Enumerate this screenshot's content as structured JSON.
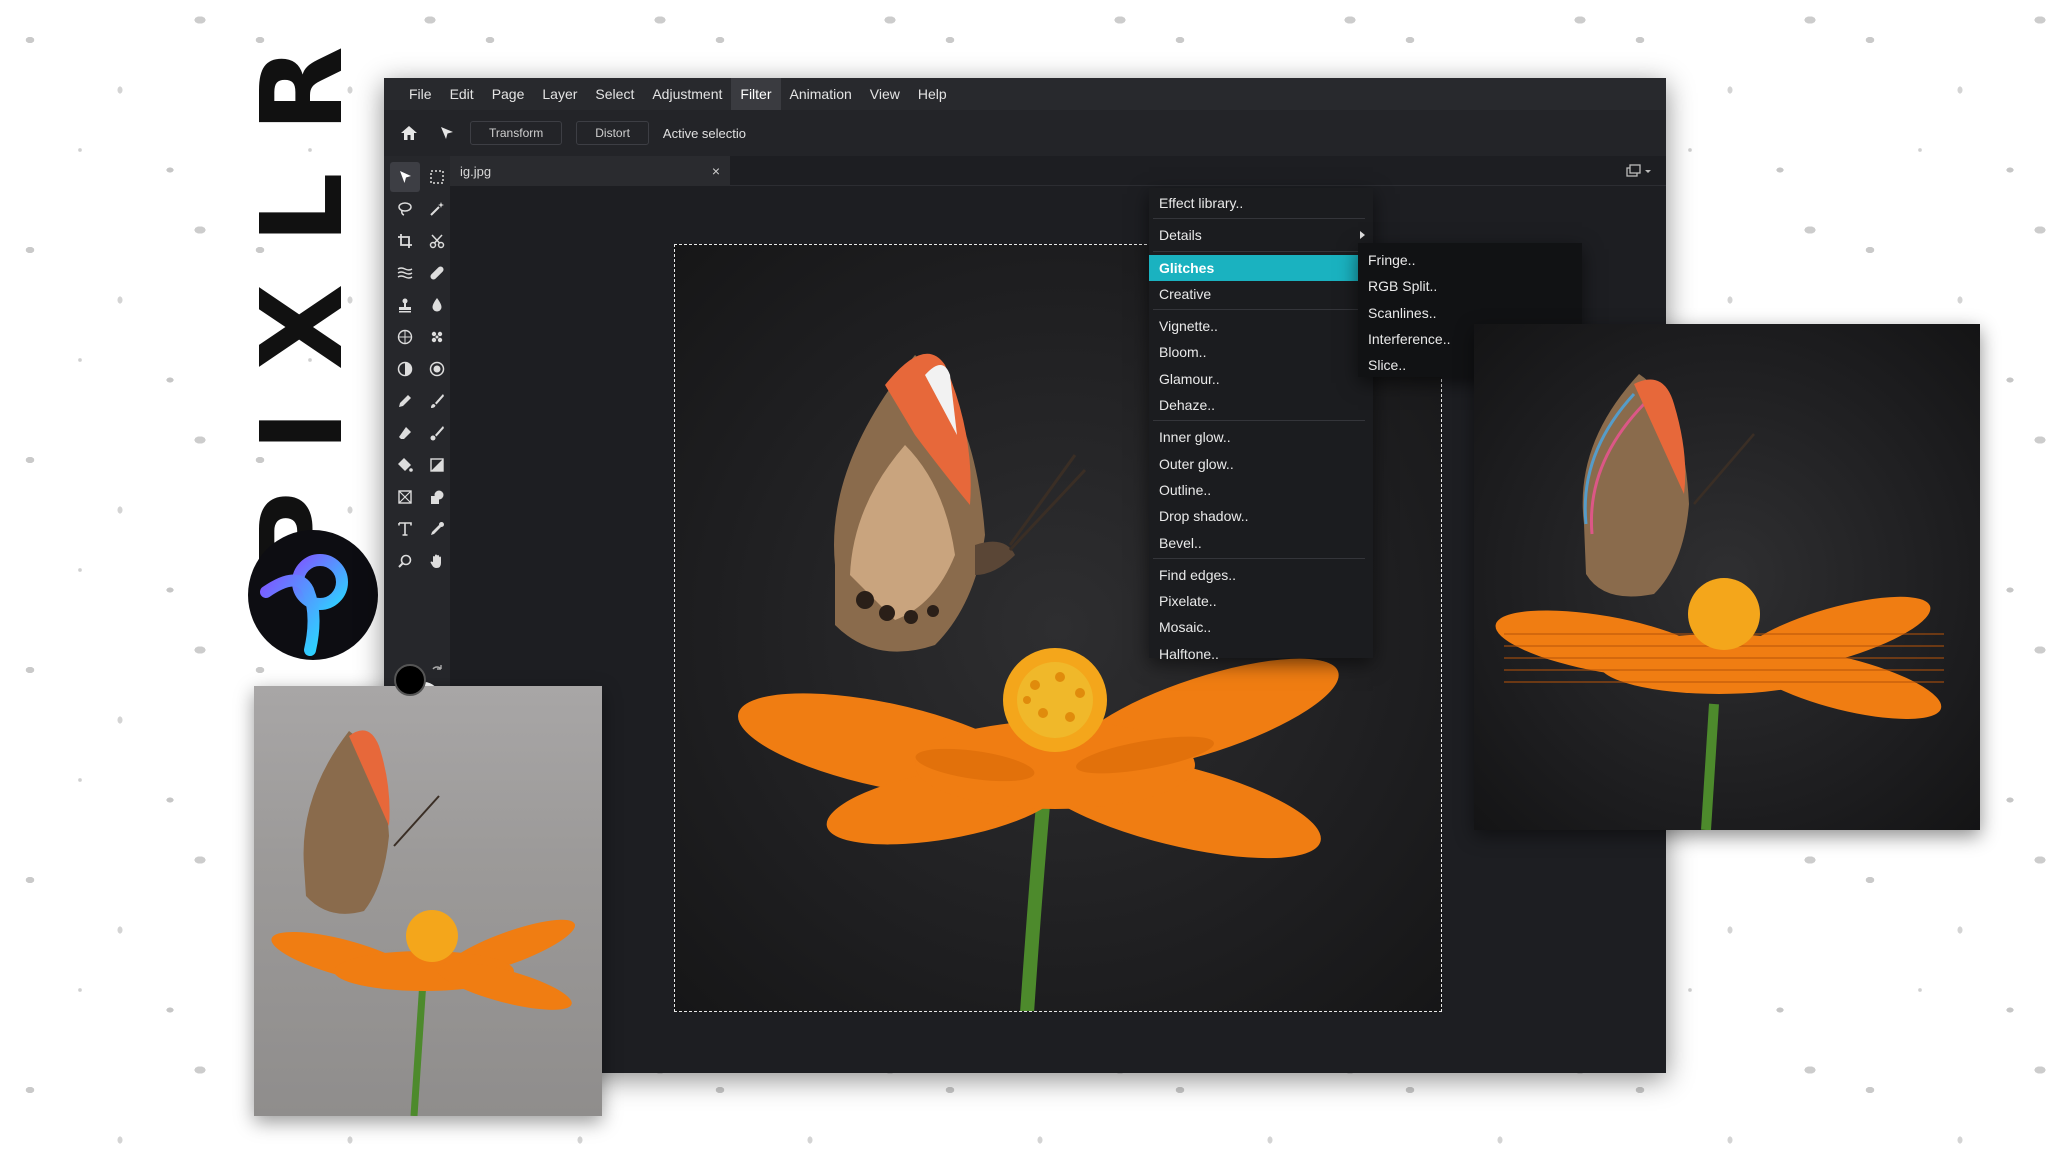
{
  "brand": {
    "wordmark": "PIXLR",
    "logo_icon": "pixlr-logo-icon"
  },
  "menubar": {
    "items": [
      "File",
      "Edit",
      "Page",
      "Layer",
      "Select",
      "Adjustment",
      "Filter",
      "Animation",
      "View",
      "Help"
    ],
    "active": "Filter"
  },
  "optionbar": {
    "transform_label": "Transform",
    "distort_label": "Distort",
    "active_selection_text": "Active selectio"
  },
  "tab": {
    "file_name": "ig.jpg",
    "close": "×"
  },
  "filter_menu": {
    "groups": [
      [
        "Effect library.."
      ],
      [
        "Details"
      ],
      [
        "Glitches",
        "Creative"
      ],
      [
        "Vignette..",
        "Bloom..",
        "Glamour..",
        "Dehaze.."
      ],
      [
        "Inner glow..",
        "Outer glow..",
        "Outline..",
        "Drop shadow..",
        "Bevel.."
      ],
      [
        "Find edges..",
        "Pixelate..",
        "Mosaic..",
        "Halftone.."
      ]
    ],
    "selected": "Glitches"
  },
  "glitches_submenu": [
    "Fringe..",
    "RGB Split..",
    "Scanlines..",
    "Interference..",
    "Slice.."
  ],
  "colors": {
    "accent": "#1ab2c0",
    "editor_bg": "#1d1e22",
    "menubar_bg": "#28292d",
    "foreground_color": "#000000",
    "background_color": "#ffffff",
    "flower_orange": "#f07d12"
  },
  "icons": {
    "tools": [
      "arrange-icon",
      "marquee-icon",
      "lasso-icon",
      "wand-icon",
      "crop-icon",
      "cutout-icon",
      "liquify-icon",
      "heal-icon",
      "clone-stamp-icon",
      "blur-icon",
      "sponge-icon",
      "pattern-icon",
      "dodge-icon",
      "burn-icon",
      "pencil-icon",
      "brush-icon",
      "eraser-icon",
      "color-replace-icon",
      "fill-icon",
      "gradient-icon",
      "frame-icon",
      "shape-icon",
      "text-icon",
      "eyedropper-icon",
      "zoom-icon",
      "hand-icon"
    ]
  }
}
